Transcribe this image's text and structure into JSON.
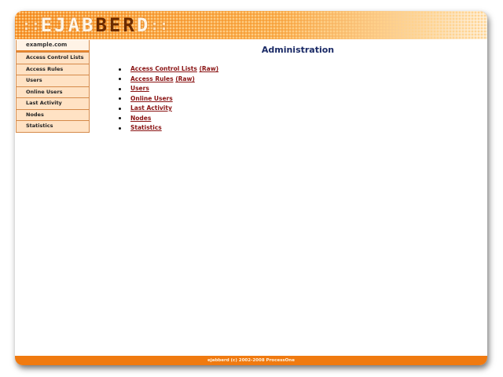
{
  "header": {
    "logo_left": "::",
    "logo_text_a": "EJAB",
    "logo_text_hl": "BER",
    "logo_text_b": "D",
    "logo_right": "::"
  },
  "sidebar": {
    "host": "example.com",
    "items": [
      {
        "label": "Access Control Lists"
      },
      {
        "label": "Access Rules"
      },
      {
        "label": "Users"
      },
      {
        "label": "Online Users"
      },
      {
        "label": "Last Activity"
      },
      {
        "label": "Nodes"
      },
      {
        "label": "Statistics"
      }
    ]
  },
  "main": {
    "title": "Administration",
    "links": [
      {
        "label": "Access Control Lists",
        "raw": "(Raw)"
      },
      {
        "label": "Access Rules",
        "raw": "(Raw)"
      },
      {
        "label": "Users"
      },
      {
        "label": "Online Users"
      },
      {
        "label": "Last Activity"
      },
      {
        "label": "Nodes"
      },
      {
        "label": "Statistics"
      }
    ]
  },
  "footer": {
    "text": "ejabberd (c) 2002-2008 ProcessOne"
  }
}
